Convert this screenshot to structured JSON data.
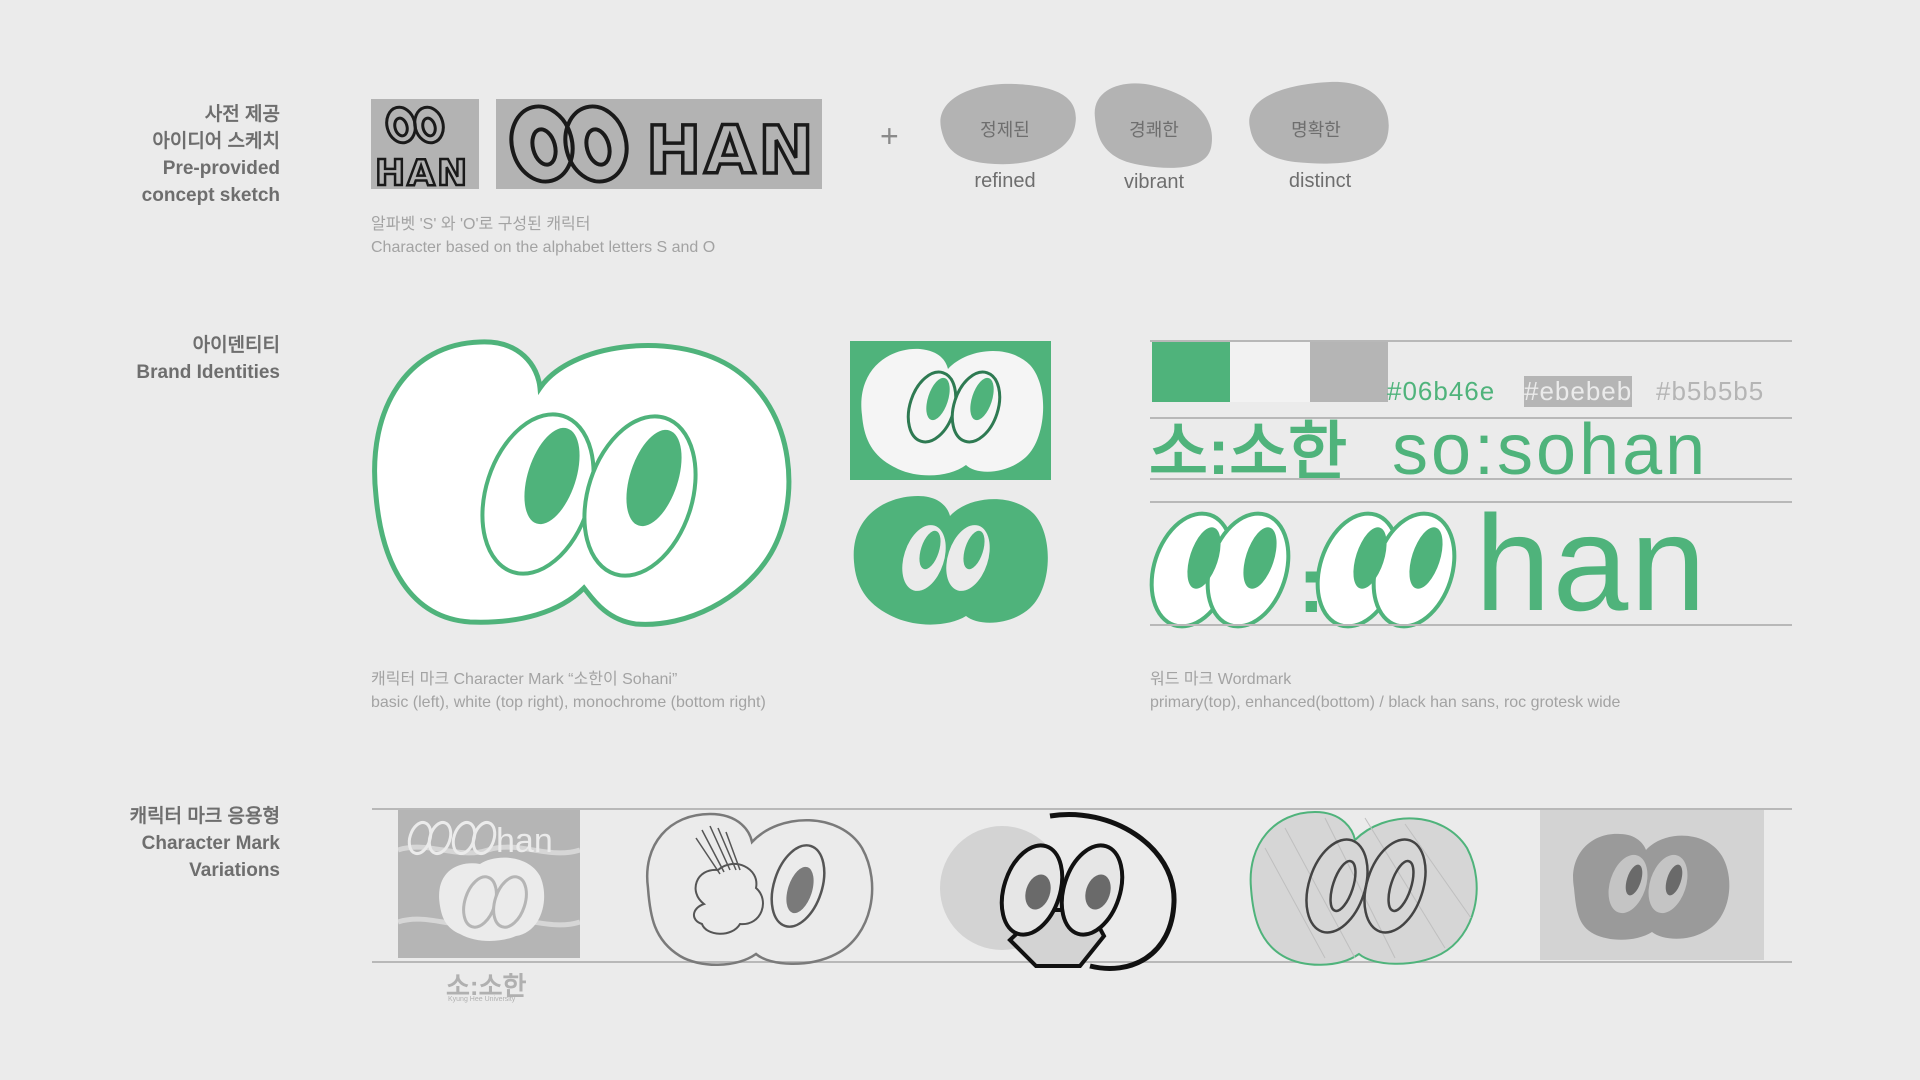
{
  "colors": {
    "green": "#06b46e",
    "light": "#ebebeb",
    "gray": "#b5b5b5",
    "mark_green": "#4fb37b"
  },
  "sections": {
    "sketch": {
      "ko_1": "사전 제공",
      "ko_2": "아이디어 스케치",
      "en_1": "Pre-provided",
      "en_2": "concept sketch"
    },
    "identity": {
      "ko": "아이덴티티",
      "en": "Brand Identities"
    },
    "variations": {
      "ko": "캐릭터 마크 응용형",
      "en_1": "Character Mark",
      "en_2": "Variations"
    }
  },
  "sketch": {
    "small_text": "HAN",
    "wide_text": "HAN",
    "plus": "+",
    "keywords": [
      {
        "ko": "정제된",
        "en": "refined"
      },
      {
        "ko": "경쾌한",
        "en": "vibrant"
      },
      {
        "ko": "명확한",
        "en": "distinct"
      }
    ],
    "caption_1": "알파벳 'S' 와 'O'로 구성된 캐릭터",
    "caption_2": "Character based on the alphabet letters S and O"
  },
  "identity": {
    "palette": [
      "#06b46e",
      "#ebebeb",
      "#b5b5b5"
    ],
    "wordmark_primary_ko": "소:소한",
    "wordmark_primary_en": "so:sohan",
    "wordmark_enhanced_en": "han",
    "wordmark_colon": ":",
    "mark_caption_1": "캐릭터 마크 Character Mark “소한이 Sohani”",
    "mark_caption_2": "basic (left), white (top right), monochrome (bottom right)",
    "wordmark_caption_1": "워드 마크 Wordmark",
    "wordmark_caption_2": "primary(top), enhanced(bottom) / black han sans, roc grotesk wide"
  },
  "variations": {
    "badge_word": "han",
    "badge_ko": "소:소한",
    "badge_small": "Kyung Hee University"
  }
}
